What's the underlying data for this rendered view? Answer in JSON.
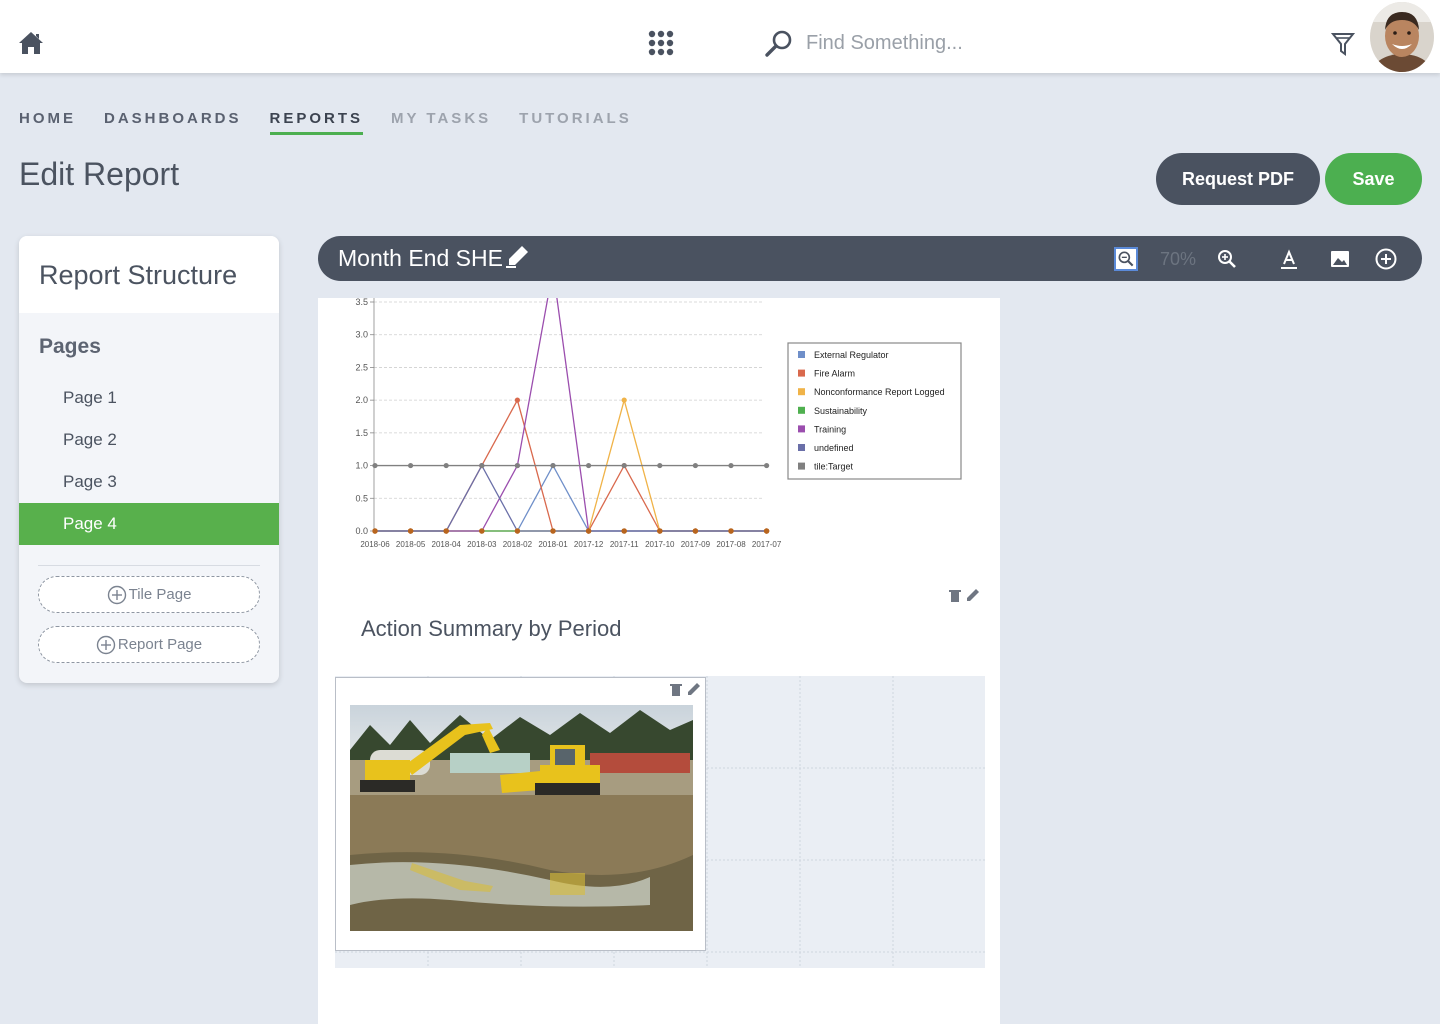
{
  "header": {
    "search_placeholder": "Find Something...",
    "icons": [
      "home-icon",
      "apps-icon",
      "search-icon",
      "filter-icon"
    ]
  },
  "nav": {
    "items": [
      {
        "label": "HOME"
      },
      {
        "label": "DASHBOARDS"
      },
      {
        "label": "REPORTS"
      },
      {
        "label": "MY TASKS"
      },
      {
        "label": "TUTORIALS"
      }
    ],
    "active": "REPORTS"
  },
  "page": {
    "title": "Edit Report",
    "request_pdf_label": "Request PDF",
    "save_label": "Save"
  },
  "sidebar": {
    "title": "Report Structure",
    "pages_label": "Pages",
    "pages": [
      {
        "label": "Page 1"
      },
      {
        "label": "Page 2"
      },
      {
        "label": "Page 3"
      },
      {
        "label": "Page 4"
      }
    ],
    "active_page": "Page 4",
    "tile_page_label": "Tile Page",
    "report_page_label": "Report Page"
  },
  "report": {
    "title": "Month End SHE",
    "zoom": "70%",
    "section_title": "Action Summary by Period"
  },
  "colors": {
    "accent_green": "#4caf50",
    "toolbar_dark": "#4a5260"
  },
  "chart_data": {
    "type": "line",
    "x": [
      "2018-06",
      "2018-05",
      "2018-04",
      "2018-03",
      "2018-02",
      "2018-01",
      "2017-12",
      "2017-11",
      "2017-10",
      "2017-09",
      "2017-08",
      "2017-07"
    ],
    "yticks": [
      "0.0",
      "0.5",
      "1.0",
      "1.5",
      "2.0",
      "2.5",
      "3.0",
      "3.5"
    ],
    "ylim": [
      0,
      3.5
    ],
    "grid": true,
    "legend_position": "right",
    "series": [
      {
        "name": "External Regulator",
        "color": "#6f8fc9",
        "values": [
          0,
          0,
          0,
          0,
          0,
          1,
          0,
          0,
          0,
          0,
          0,
          0
        ]
      },
      {
        "name": "Fire Alarm",
        "color": "#d9694d",
        "values": [
          0,
          0,
          0,
          1,
          2,
          0,
          0,
          1,
          0,
          0,
          0,
          0
        ]
      },
      {
        "name": "Nonconformance Report Logged",
        "color": "#f0b348",
        "values": [
          0,
          0,
          0,
          0,
          0,
          0,
          0,
          2,
          0,
          0,
          0,
          0
        ]
      },
      {
        "name": "Sustainability",
        "color": "#4fb04f",
        "values": [
          0,
          0,
          0,
          0,
          0,
          0,
          0,
          0,
          0,
          0,
          0,
          0
        ]
      },
      {
        "name": "Training",
        "color": "#9b4eae",
        "values": [
          0,
          0,
          0,
          0,
          1,
          4,
          0,
          0,
          0,
          0,
          0,
          0
        ]
      },
      {
        "name": "undefined",
        "color": "#6a6fa8",
        "values": [
          0,
          0,
          0,
          1,
          0,
          0,
          0,
          0,
          0,
          0,
          0,
          0
        ]
      },
      {
        "name": "tile:Target",
        "color": "#808080",
        "values": [
          1,
          1,
          1,
          1,
          1,
          1,
          1,
          1,
          1,
          1,
          1,
          1
        ]
      }
    ]
  }
}
